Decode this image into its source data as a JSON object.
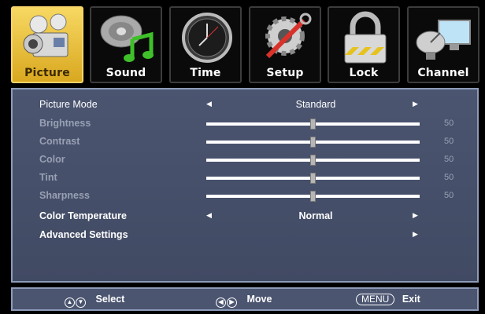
{
  "tabs": [
    {
      "label": "Picture",
      "icon": "camera-icon",
      "active": true
    },
    {
      "label": "Sound",
      "icon": "speaker-icon",
      "active": false
    },
    {
      "label": "Time",
      "icon": "clock-icon",
      "active": false
    },
    {
      "label": "Setup",
      "icon": "gear-wrench-icon",
      "active": false
    },
    {
      "label": "Lock",
      "icon": "padlock-icon",
      "active": false
    },
    {
      "label": "Channel",
      "icon": "satellite-dish-icon",
      "active": false
    }
  ],
  "picture_menu": {
    "picture_mode": {
      "label": "Picture Mode",
      "value": "Standard"
    },
    "sliders": [
      {
        "label": "Brightness",
        "value": 50
      },
      {
        "label": "Contrast",
        "value": 50
      },
      {
        "label": "Color",
        "value": 50
      },
      {
        "label": "Tint",
        "value": 50
      },
      {
        "label": "Sharpness",
        "value": 50
      }
    ],
    "color_temperature": {
      "label": "Color Temperature",
      "value": "Normal"
    },
    "advanced_settings": {
      "label": "Advanced Settings"
    }
  },
  "footer": {
    "select_label": "Select",
    "move_label": "Move",
    "menu_key": "MENU",
    "exit_label": "Exit"
  },
  "colors": {
    "panel_bg": "#4b5570",
    "panel_border": "#8d9bb8",
    "active_tab": "#f0c840",
    "disabled_text": "#98a0b4"
  }
}
